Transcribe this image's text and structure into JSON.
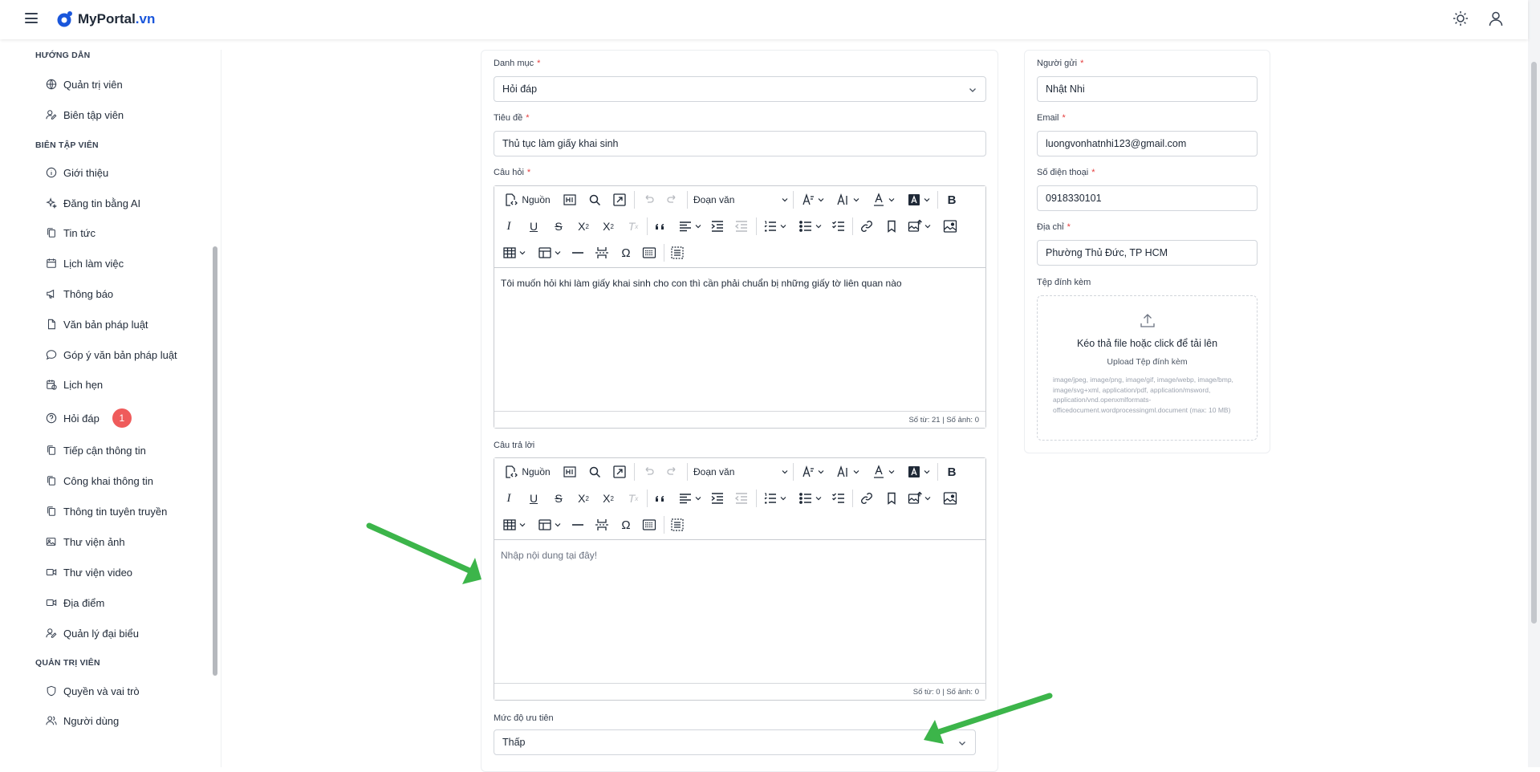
{
  "header": {
    "brand": "MyPortal",
    "brand_tld": ".vn",
    "icons": [
      "menu-icon",
      "theme-sun-icon",
      "user-icon"
    ]
  },
  "sidebar": {
    "sections": [
      {
        "title": "HƯỚNG DẪN",
        "items": [
          {
            "label": "Quản trị viên",
            "icon": "globe-icon"
          },
          {
            "label": "Biên tập viên",
            "icon": "user-edit-icon"
          }
        ]
      },
      {
        "title": "BIÊN TẬP VIÊN",
        "items": [
          {
            "label": "Giới thiệu",
            "icon": "info-icon"
          },
          {
            "label": "Đăng tin bằng AI",
            "icon": "sparkles-icon"
          },
          {
            "label": "Tin tức",
            "icon": "copy-icon"
          },
          {
            "label": "Lịch làm việc",
            "icon": "calendar-icon"
          },
          {
            "label": "Thông báo",
            "icon": "megaphone-icon"
          },
          {
            "label": "Văn bản pháp luật",
            "icon": "document-icon"
          },
          {
            "label": "Góp ý văn bản pháp luật",
            "icon": "message-icon"
          },
          {
            "label": "Lịch hẹn",
            "icon": "calendar-clock-icon"
          },
          {
            "label": "Hỏi đáp",
            "icon": "help-circle-icon",
            "badge": "1"
          },
          {
            "label": "Tiếp cận thông tin",
            "icon": "copy-icon"
          },
          {
            "label": "Công khai thông tin",
            "icon": "copy-icon"
          },
          {
            "label": "Thông tin tuyên truyền",
            "icon": "copy-icon"
          },
          {
            "label": "Thư viện ảnh",
            "icon": "images-icon"
          },
          {
            "label": "Thư viện video",
            "icon": "video-icon"
          },
          {
            "label": "Địa điểm",
            "icon": "video-icon"
          },
          {
            "label": "Quản lý đại biểu",
            "icon": "user-edit-icon"
          }
        ]
      },
      {
        "title": "QUẢN TRỊ VIÊN",
        "items": [
          {
            "label": "Quyền và vai trò",
            "icon": "shield-icon"
          },
          {
            "label": "Người dùng",
            "icon": "users-icon"
          }
        ]
      }
    ]
  },
  "form": {
    "category": {
      "label": "Danh mục",
      "value": "Hỏi đáp"
    },
    "title": {
      "label": "Tiêu đề",
      "value": "Thủ tục làm giấy khai sinh"
    },
    "question": {
      "label": "Câu hỏi",
      "content": "Tôi muốn hỏi khi làm giấy khai sinh cho con thì cần phải chuẩn bị những giấy tờ liên quan nào",
      "status": "Số từ: 21 | Số ảnh: 0"
    },
    "answer": {
      "label": "Câu trả lời",
      "placeholder": "Nhập nội dung tại đây!",
      "status": "Số từ: 0 | Số ảnh: 0"
    },
    "priority": {
      "label": "Mức độ ưu tiên",
      "value": "Thấp"
    },
    "toolbar": {
      "source_label": "Nguồn",
      "paragraph_label": "Đoạn văn"
    }
  },
  "sender": {
    "name": {
      "label": "Người gửi",
      "value": "Nhật Nhi"
    },
    "email": {
      "label": "Email",
      "value": "luongvonhatnhi123@gmail.com"
    },
    "phone": {
      "label": "Số điện thoại",
      "value": "0918330101"
    },
    "address": {
      "label": "Địa chỉ",
      "value": "Phường Thủ Đức, TP HCM"
    },
    "attachment": {
      "label": "Tệp đính kèm",
      "drop_text": "Kéo thả file hoặc click để tải lên",
      "upload_text": "Upload Tệp đính kèm",
      "types_text": "image/jpeg, image/png, image/gif, image/webp, image/bmp, image/svg+xml, application/pdf, application/msword, application/vnd.openxmlformats-officedocument.wordprocessingml.document (max: 10 MB)"
    }
  },
  "colors": {
    "brand": "#1a56db",
    "badge": "#ef5b5b",
    "required": "#e53e3e",
    "annotation_arrow": "#3cb54a"
  }
}
